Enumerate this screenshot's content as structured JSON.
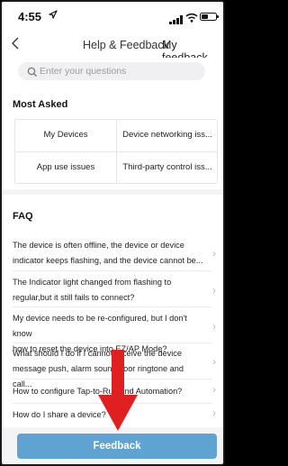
{
  "status_bar": {
    "time": "4:55",
    "location_icon": "location-arrow-icon",
    "signal_icon": "signal-icon",
    "wifi_icon": "wifi-icon",
    "battery_icon": "battery-icon"
  },
  "nav": {
    "back_icon": "chevron-left-icon",
    "title": "Help & Feedback",
    "right_link": "My feedback"
  },
  "search": {
    "placeholder": "Enter your questions"
  },
  "most_asked": {
    "title": "Most Asked",
    "items": [
      {
        "label": "My Devices"
      },
      {
        "label": "Device networking iss..."
      },
      {
        "label": "App use issues"
      },
      {
        "label": "Third-party control iss..."
      }
    ]
  },
  "faq": {
    "title": "FAQ",
    "items": [
      {
        "line1": "The device is often offline, the device or device",
        "line2": "indicator keeps flashing, and the device cannot be..."
      },
      {
        "line1": "The Indicator light changed from flashing to",
        "line2": "regular,but it still fails to connect?"
      },
      {
        "line1": "My device needs to be re-configured, but I don't know",
        "line2": "how to reset the device into EZ/AP Mode?"
      },
      {
        "line1": "What should I do if I cannot receive the device",
        "line2": "message push, alarm sound/door ringtone and call..."
      },
      {
        "line1": "How to configure Tap-to-Run and Automation?",
        "line2": ""
      },
      {
        "line1": "How do I share a device?",
        "line2": ""
      }
    ]
  },
  "feedback_button": {
    "label": "Feedback"
  },
  "colors": {
    "accent": "#5fa3d3",
    "arrow": "#e02020"
  }
}
